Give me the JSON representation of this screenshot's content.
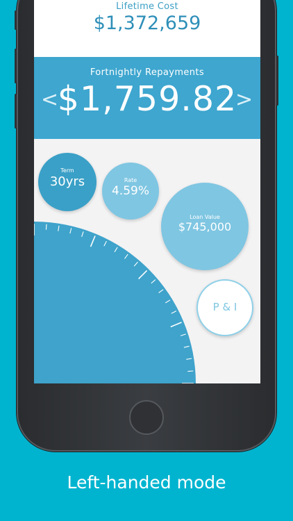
{
  "lifetime": {
    "label": "Lifetime Cost",
    "value": "$1,372,659"
  },
  "repayments": {
    "label": "Fortnightly Repayments",
    "value": "$1,759.82",
    "prev_symbol": "<",
    "next_symbol": ">"
  },
  "bubbles": {
    "term": {
      "caption": "Term",
      "value": "30yrs"
    },
    "rate": {
      "caption": "Rate",
      "value": "4.59%"
    },
    "loan": {
      "caption": "Loan Value",
      "value": "$745,000"
    },
    "type": {
      "value": "P & I"
    }
  },
  "caption": "Left-handed mode",
  "colors": {
    "background": "#00b4cf",
    "band": "#3ea6cf",
    "term_bubble": "#3aa0c7",
    "light_bubble": "#7fc6e2",
    "dial": "#3fa3cb",
    "text_blue": "#2e8fb8"
  }
}
